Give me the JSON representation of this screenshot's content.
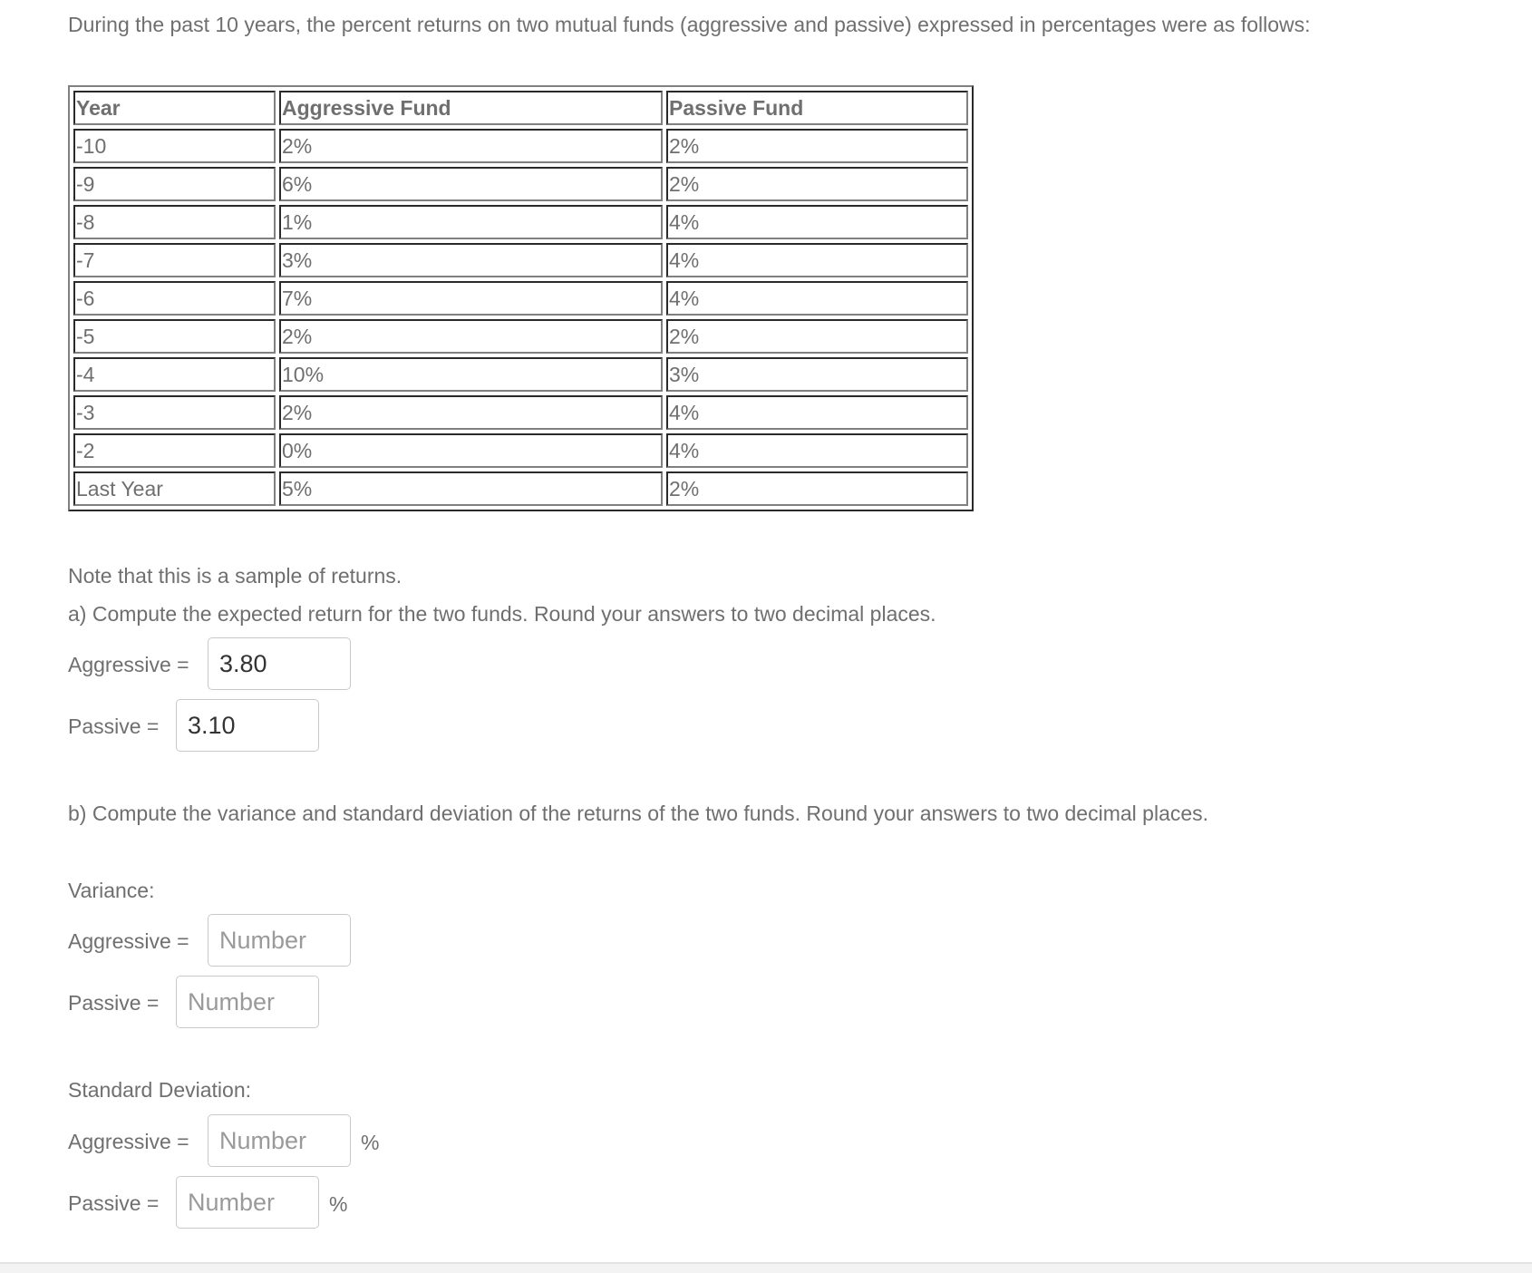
{
  "intro": "During the past 10 years, the percent returns on two mutual funds (aggressive and passive) expressed in percentages were as follows:",
  "table": {
    "headers": [
      "Year",
      "Aggressive Fund",
      "Passive Fund"
    ],
    "rows": [
      [
        "-10",
        "2%",
        "2%"
      ],
      [
        "-9",
        "6%",
        "2%"
      ],
      [
        "-8",
        "1%",
        "4%"
      ],
      [
        "-7",
        "3%",
        "4%"
      ],
      [
        "-6",
        "7%",
        "4%"
      ],
      [
        "-5",
        "2%",
        "2%"
      ],
      [
        "-4",
        "10%",
        "3%"
      ],
      [
        "-3",
        "2%",
        "4%"
      ],
      [
        "-2",
        "0%",
        "4%"
      ],
      [
        "Last Year",
        "5%",
        "2%"
      ]
    ]
  },
  "note": "Note that this is a sample of returns.",
  "part_a": {
    "question": "a) Compute the expected return for the two funds.  Round your answers to two decimal places.",
    "aggressive_label": "Aggressive =",
    "aggressive_value": "3.80",
    "passive_label": "Passive =",
    "passive_value": "3.10"
  },
  "part_b": {
    "question": "b) Compute the variance and standard deviation of the returns of the two funds.  Round your answers to two decimal places.",
    "variance": {
      "heading": "Variance:",
      "aggressive_label": "Aggressive =",
      "aggressive_value": "",
      "aggressive_placeholder": "Number",
      "passive_label": "Passive =",
      "passive_value": "",
      "passive_placeholder": "Number"
    },
    "std_dev": {
      "heading": "Standard Deviation:",
      "aggressive_label": "Aggressive =",
      "aggressive_value": "",
      "aggressive_placeholder": "Number",
      "aggressive_unit": "%",
      "passive_label": "Passive =",
      "passive_value": "",
      "passive_placeholder": "Number",
      "passive_unit": "%"
    }
  }
}
